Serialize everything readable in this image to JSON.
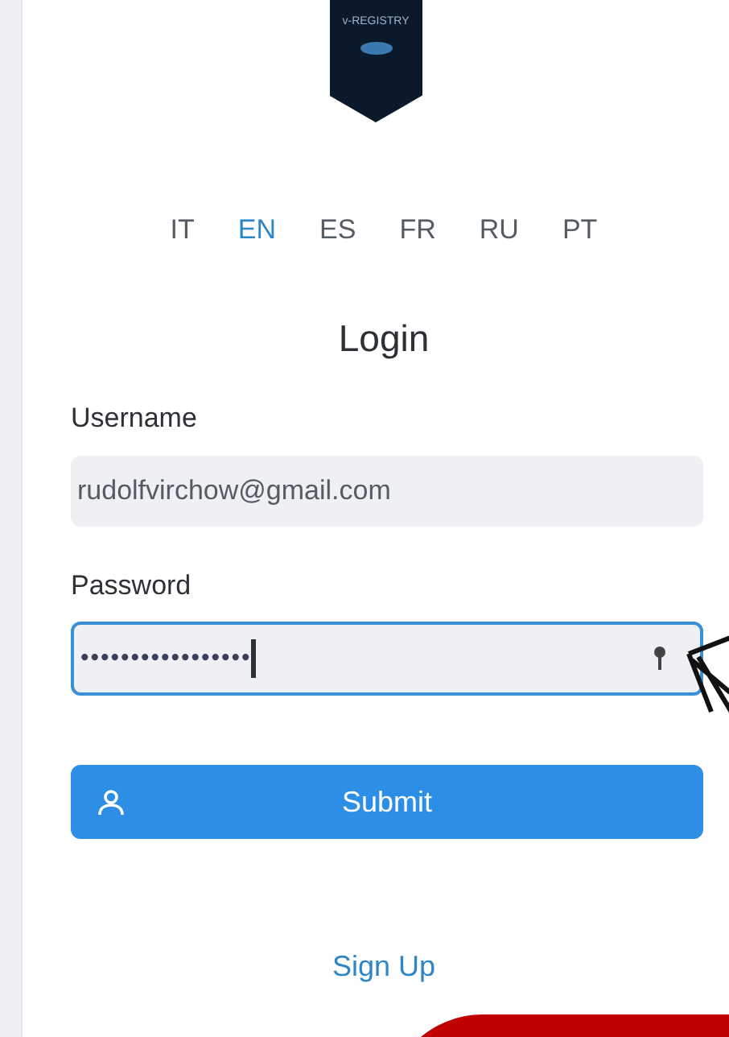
{
  "logo": {
    "text": "v-REGISTRY"
  },
  "languages": [
    {
      "label": "IT",
      "selected": false
    },
    {
      "label": "EN",
      "selected": true
    },
    {
      "label": "ES",
      "selected": false
    },
    {
      "label": "FR",
      "selected": false
    },
    {
      "label": "RU",
      "selected": false
    },
    {
      "label": "PT",
      "selected": false
    }
  ],
  "form": {
    "title": "Login",
    "username_label": "Username",
    "username_value": "rudolfvirchow@gmail.com",
    "password_label": "Password",
    "password_masked": "•••••••••••••••••",
    "password_focused": true,
    "submit": "Submit"
  },
  "signup_link": "Sign Up"
}
